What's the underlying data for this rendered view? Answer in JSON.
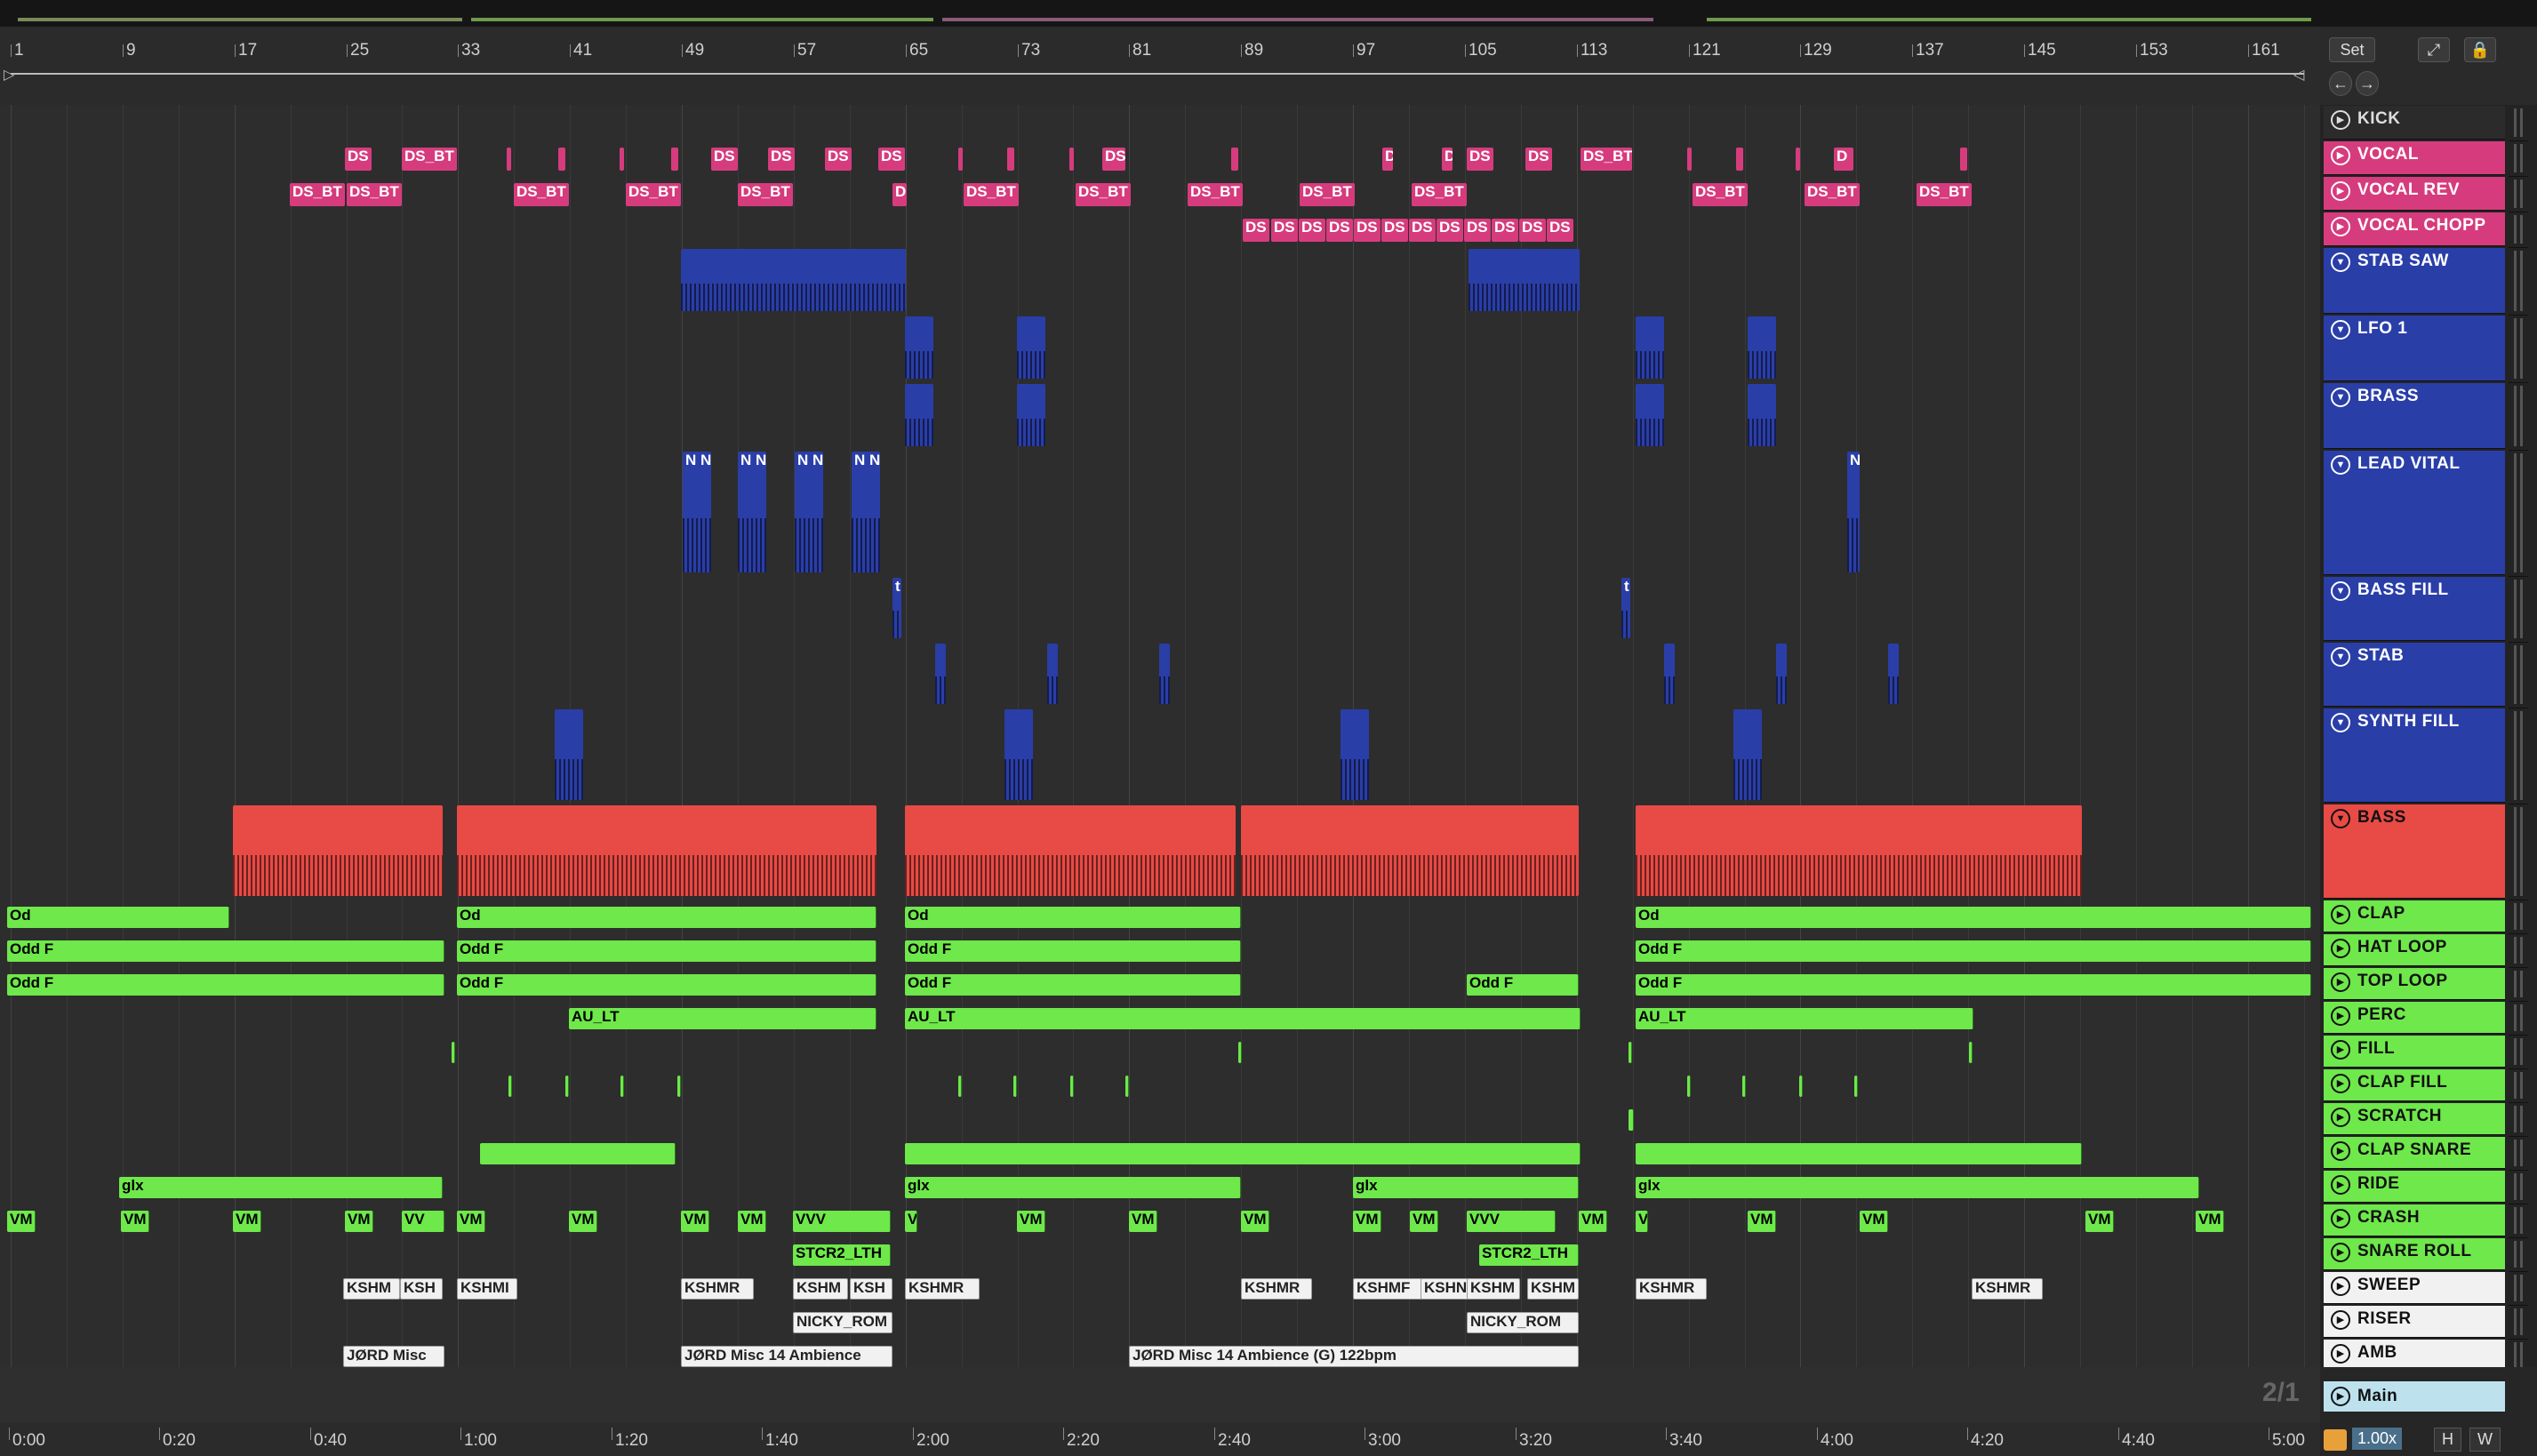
{
  "ruler": {
    "bars": [
      "1",
      "9",
      "17",
      "25",
      "33",
      "41",
      "49",
      "57",
      "65",
      "73",
      "81",
      "89",
      "97",
      "105",
      "113",
      "121",
      "129",
      "137",
      "145",
      "153",
      "161"
    ]
  },
  "controls": {
    "set_label": "Set",
    "expand_icon": "expand-icon",
    "lock_icon": "lock-icon",
    "back_icon": "arrow-left-icon",
    "forward_icon": "arrow-right-icon"
  },
  "tracks": [
    {
      "name": "KICK",
      "color": "#2b2b2b",
      "text": "#dddddd",
      "btn": "▶",
      "h": 40
    },
    {
      "name": "VOCAL",
      "color": "#d63c7d",
      "text": "#ffffff",
      "btn": "▶",
      "h": 40
    },
    {
      "name": "VOCAL REV",
      "color": "#d63c7d",
      "text": "#ffffff",
      "btn": "▶",
      "h": 40
    },
    {
      "name": "VOCAL CHOPP",
      "color": "#d63c7d",
      "text": "#ffffff",
      "btn": "▶",
      "h": 40
    },
    {
      "name": "STAB SAW",
      "color": "#2a3ea8",
      "text": "#ffffff",
      "btn": "▼",
      "h": 76
    },
    {
      "name": "LFO 1",
      "color": "#2a3ea8",
      "text": "#ffffff",
      "btn": "▼",
      "h": 76
    },
    {
      "name": "BRASS",
      "color": "#2a3ea8",
      "text": "#ffffff",
      "btn": "▼",
      "h": 76
    },
    {
      "name": "LEAD VITAL",
      "color": "#2a3ea8",
      "text": "#ffffff",
      "btn": "▼",
      "h": 142
    },
    {
      "name": "BASS FILL",
      "color": "#2a3ea8",
      "text": "#ffffff",
      "btn": "▼",
      "h": 74
    },
    {
      "name": "STAB",
      "color": "#2a3ea8",
      "text": "#ffffff",
      "btn": "▼",
      "h": 74
    },
    {
      "name": "SYNTH FILL",
      "color": "#2a3ea8",
      "text": "#ffffff",
      "btn": "▼",
      "h": 108
    },
    {
      "name": "BASS",
      "color": "#e84a45",
      "text": "#111111",
      "btn": "▼",
      "h": 108
    },
    {
      "name": "CLAP",
      "color": "#6ee84b",
      "text": "#111111",
      "btn": "▶",
      "h": 38
    },
    {
      "name": "HAT LOOP",
      "color": "#6ee84b",
      "text": "#111111",
      "btn": "▶",
      "h": 38
    },
    {
      "name": "TOP LOOP",
      "color": "#6ee84b",
      "text": "#111111",
      "btn": "▶",
      "h": 38
    },
    {
      "name": "PERC",
      "color": "#6ee84b",
      "text": "#111111",
      "btn": "▶",
      "h": 38
    },
    {
      "name": "FILL",
      "color": "#6ee84b",
      "text": "#111111",
      "btn": "▶",
      "h": 38
    },
    {
      "name": "CLAP FILL",
      "color": "#6ee84b",
      "text": "#111111",
      "btn": "▶",
      "h": 38
    },
    {
      "name": "SCRATCH",
      "color": "#6ee84b",
      "text": "#111111",
      "btn": "▶",
      "h": 38
    },
    {
      "name": "CLAP SNARE",
      "color": "#6ee84b",
      "text": "#111111",
      "btn": "▶",
      "h": 38
    },
    {
      "name": "RIDE",
      "color": "#6ee84b",
      "text": "#111111",
      "btn": "▶",
      "h": 38
    },
    {
      "name": "CRASH",
      "color": "#6ee84b",
      "text": "#111111",
      "btn": "▶",
      "h": 38
    },
    {
      "name": "SNARE ROLL",
      "color": "#6ee84b",
      "text": "#111111",
      "btn": "▶",
      "h": 38
    },
    {
      "name": "SWEEP",
      "color": "#f1f1f1",
      "text": "#111111",
      "btn": "▶",
      "h": 38
    },
    {
      "name": "RISER",
      "color": "#f1f1f1",
      "text": "#111111",
      "btn": "▶",
      "h": 38
    },
    {
      "name": "AMB",
      "color": "#f1f1f1",
      "text": "#111111",
      "btn": "▶",
      "h": 38
    }
  ],
  "clips": {
    "VOCAL": [
      [
        "DS",
        388,
        30
      ],
      [
        "DS_BT",
        452,
        62
      ],
      [
        "",
        570,
        5
      ],
      [
        "",
        628,
        8
      ],
      [
        "",
        697,
        5
      ],
      [
        "",
        755,
        8
      ],
      [
        "DS",
        800,
        30
      ],
      [
        "DS",
        864,
        30
      ],
      [
        "DS",
        928,
        30
      ],
      [
        "DS",
        988,
        30
      ],
      [
        "",
        1078,
        5
      ],
      [
        "",
        1133,
        8
      ],
      [
        "",
        1203,
        5
      ],
      [
        "DS",
        1240,
        26
      ],
      [
        "",
        1385,
        8
      ],
      [
        "D",
        1555,
        12
      ],
      [
        "D",
        1622,
        12
      ],
      [
        "DS",
        1650,
        30
      ],
      [
        "DS",
        1716,
        30
      ],
      [
        "DS_BT",
        1778,
        58
      ],
      [
        "",
        1898,
        5
      ],
      [
        "",
        1953,
        8
      ],
      [
        "",
        2020,
        5
      ],
      [
        "D",
        2063,
        22
      ],
      [
        "",
        2205,
        8
      ]
    ],
    "VOCAL REV": [
      [
        "DS_BT",
        326,
        62
      ],
      [
        "DS_BT",
        390,
        62
      ],
      [
        "DS_BT",
        578,
        62
      ],
      [
        "DS_BT",
        704,
        62
      ],
      [
        "DS_BT",
        830,
        62
      ],
      [
        "D",
        1004,
        16
      ],
      [
        "DS_BT",
        1084,
        62
      ],
      [
        "DS_BT",
        1210,
        62
      ],
      [
        "DS_BT",
        1336,
        62
      ],
      [
        "DS_BT",
        1462,
        62
      ],
      [
        "DS_BT",
        1588,
        62
      ],
      [
        "DS_BT",
        1904,
        62
      ],
      [
        "DS_BT",
        2030,
        62
      ],
      [
        "DS_BT",
        2156,
        62
      ]
    ],
    "VOCAL CHOPP": [
      [
        "DS",
        1398,
        30
      ],
      [
        "DS",
        1430,
        30
      ],
      [
        "DS",
        1461,
        30
      ],
      [
        "DS",
        1492,
        30
      ],
      [
        "DS",
        1523,
        30
      ],
      [
        "DS",
        1554,
        30
      ],
      [
        "DS",
        1585,
        30
      ],
      [
        "DS",
        1616,
        30
      ],
      [
        "DS",
        1647,
        30
      ],
      [
        "DS",
        1678,
        30
      ],
      [
        "DS",
        1709,
        30
      ],
      [
        "DS",
        1740,
        30
      ]
    ],
    "STAB SAW": [
      [
        "",
        766,
        253
      ],
      [
        "",
        1652,
        125
      ]
    ],
    "LFO 1": [
      [
        "",
        1018,
        32
      ],
      [
        "",
        1144,
        32
      ],
      [
        "",
        1840,
        32
      ],
      [
        "",
        1966,
        32
      ]
    ],
    "BRASS": [
      [
        "",
        1018,
        32
      ],
      [
        "",
        1144,
        32
      ],
      [
        "",
        1840,
        32
      ],
      [
        "",
        1966,
        32
      ]
    ],
    "LEAD VITAL": [
      [
        "N N",
        768,
        32
      ],
      [
        "N N",
        830,
        32
      ],
      [
        "N N",
        894,
        32
      ],
      [
        "N N",
        958,
        32
      ],
      [
        "N",
        2078,
        14
      ]
    ],
    "BASS FILL": [
      [
        "t",
        1004,
        10
      ],
      [
        "t",
        1824,
        10
      ]
    ],
    "STAB": [
      [
        "",
        1052,
        12
      ],
      [
        "",
        1178,
        12
      ],
      [
        "",
        1304,
        12
      ],
      [
        "",
        1872,
        12
      ],
      [
        "",
        1998,
        12
      ],
      [
        "",
        2124,
        12
      ]
    ],
    "SYNTH FILL": [
      [
        "",
        624,
        32
      ],
      [
        "",
        1130,
        32
      ],
      [
        "",
        1508,
        32
      ],
      [
        "",
        1950,
        32
      ]
    ],
    "BASS": [
      [
        "",
        262,
        236
      ],
      [
        "",
        514,
        472
      ],
      [
        "",
        1018,
        372
      ],
      [
        "",
        1396,
        380
      ],
      [
        "",
        1840,
        502
      ]
    ],
    "CLAP": [
      [
        "Od",
        8,
        250
      ],
      [
        "Od",
        514,
        472
      ],
      [
        "Od",
        1018,
        378
      ],
      [
        "Od",
        1840,
        760
      ]
    ],
    "HAT LOOP": [
      [
        "Odd F",
        8,
        492
      ],
      [
        "Odd F",
        514,
        472
      ],
      [
        "Odd F",
        1018,
        378
      ],
      [
        "Odd F",
        1840,
        760
      ]
    ],
    "TOP LOOP": [
      [
        "Odd F",
        8,
        492
      ],
      [
        "Odd F",
        514,
        472
      ],
      [
        "Odd F",
        1018,
        378
      ],
      [
        "Odd F",
        1650,
        126
      ],
      [
        "Odd F",
        1840,
        760
      ]
    ],
    "PERC": [
      [
        "AU_LT",
        640,
        346
      ],
      [
        "AU_LT",
        1018,
        760
      ],
      [
        "AU_LT",
        1840,
        380
      ]
    ],
    "FILL": [
      [
        "",
        508,
        4
      ],
      [
        "",
        1393,
        4
      ],
      [
        "",
        1832,
        4
      ],
      [
        "",
        2215,
        4
      ]
    ],
    "CLAP FILL": [
      [
        "",
        572,
        4
      ],
      [
        "",
        636,
        4
      ],
      [
        "",
        698,
        4
      ],
      [
        "",
        762,
        4
      ],
      [
        "",
        1078,
        4
      ],
      [
        "",
        1140,
        4
      ],
      [
        "",
        1204,
        4
      ],
      [
        "",
        1266,
        4
      ],
      [
        "",
        1898,
        4
      ],
      [
        "",
        1960,
        4
      ],
      [
        "",
        2024,
        4
      ],
      [
        "",
        2086,
        4
      ]
    ],
    "SCRATCH": [
      [
        "",
        1832,
        6
      ]
    ],
    "CLAP SNARE": [
      [
        "",
        540,
        220
      ],
      [
        "",
        1018,
        760
      ],
      [
        "",
        1840,
        502
      ]
    ],
    "RIDE": [
      [
        "glx",
        134,
        364
      ],
      [
        "glx",
        1018,
        378
      ],
      [
        "glx",
        1522,
        254
      ],
      [
        "glx",
        1840,
        634
      ]
    ],
    "CRASH": [
      [
        "VM",
        8,
        32
      ],
      [
        "VM",
        136,
        32
      ],
      [
        "VM",
        262,
        32
      ],
      [
        "VM",
        388,
        32
      ],
      [
        "VV",
        452,
        48
      ],
      [
        "VM",
        514,
        32
      ],
      [
        "VM",
        640,
        32
      ],
      [
        "VM",
        766,
        32
      ],
      [
        "VM",
        830,
        32
      ],
      [
        "VVV",
        892,
        110
      ],
      [
        "V",
        1018,
        14
      ],
      [
        "VM",
        1144,
        32
      ],
      [
        "VM",
        1270,
        32
      ],
      [
        "VM",
        1396,
        32
      ],
      [
        "VM",
        1522,
        32
      ],
      [
        "VM",
        1586,
        32
      ],
      [
        "VVV",
        1650,
        100
      ],
      [
        "VM",
        1776,
        32
      ],
      [
        "V",
        1840,
        14
      ],
      [
        "VM",
        1966,
        32
      ],
      [
        "VM",
        2092,
        32
      ],
      [
        "VM",
        2346,
        32
      ],
      [
        "VM",
        2470,
        32
      ]
    ],
    "SNARE ROLL": [
      [
        "STCR2_LTH",
        892,
        110
      ],
      [
        "STCR2_LTH",
        1664,
        112
      ]
    ],
    "SWEEP": [
      [
        "KSHM",
        386,
        64
      ],
      [
        "KSH",
        450,
        48
      ],
      [
        "KSHMI",
        514,
        68
      ],
      [
        "KSHMR",
        766,
        82
      ],
      [
        "KSHM",
        892,
        62
      ],
      [
        "KSH",
        956,
        48
      ],
      [
        "KSHMR",
        1018,
        84
      ],
      [
        "KSHMR",
        1396,
        80
      ],
      [
        "KSHMF",
        1522,
        78
      ],
      [
        "KSHN",
        1598,
        60
      ],
      [
        "KSHM",
        1650,
        60
      ],
      [
        "KSHM",
        1718,
        58
      ],
      [
        "KSHMR",
        1840,
        80
      ],
      [
        "KSHMR",
        2218,
        80
      ]
    ],
    "RISER": [
      [
        "NICKY_ROM",
        892,
        112
      ],
      [
        "NICKY_ROM",
        1650,
        126
      ]
    ],
    "AMB": [
      [
        "JØRD Misc",
        386,
        114
      ],
      [
        "JØRD Misc 14 Ambience",
        766,
        238
      ],
      [
        "JØRD Misc 14 Ambience (G) 122bpm",
        1270,
        506
      ]
    ]
  },
  "main_track": {
    "name": "Main",
    "loop_count": "2/1"
  },
  "time_ruler": [
    "0:00",
    "0:20",
    "0:40",
    "1:00",
    "1:20",
    "1:40",
    "2:00",
    "2:20",
    "2:40",
    "3:00",
    "3:20",
    "3:40",
    "4:00",
    "4:20",
    "4:40",
    "5:00"
  ],
  "status": {
    "zoom": "1.00x",
    "h_label": "H",
    "w_label": "W"
  }
}
